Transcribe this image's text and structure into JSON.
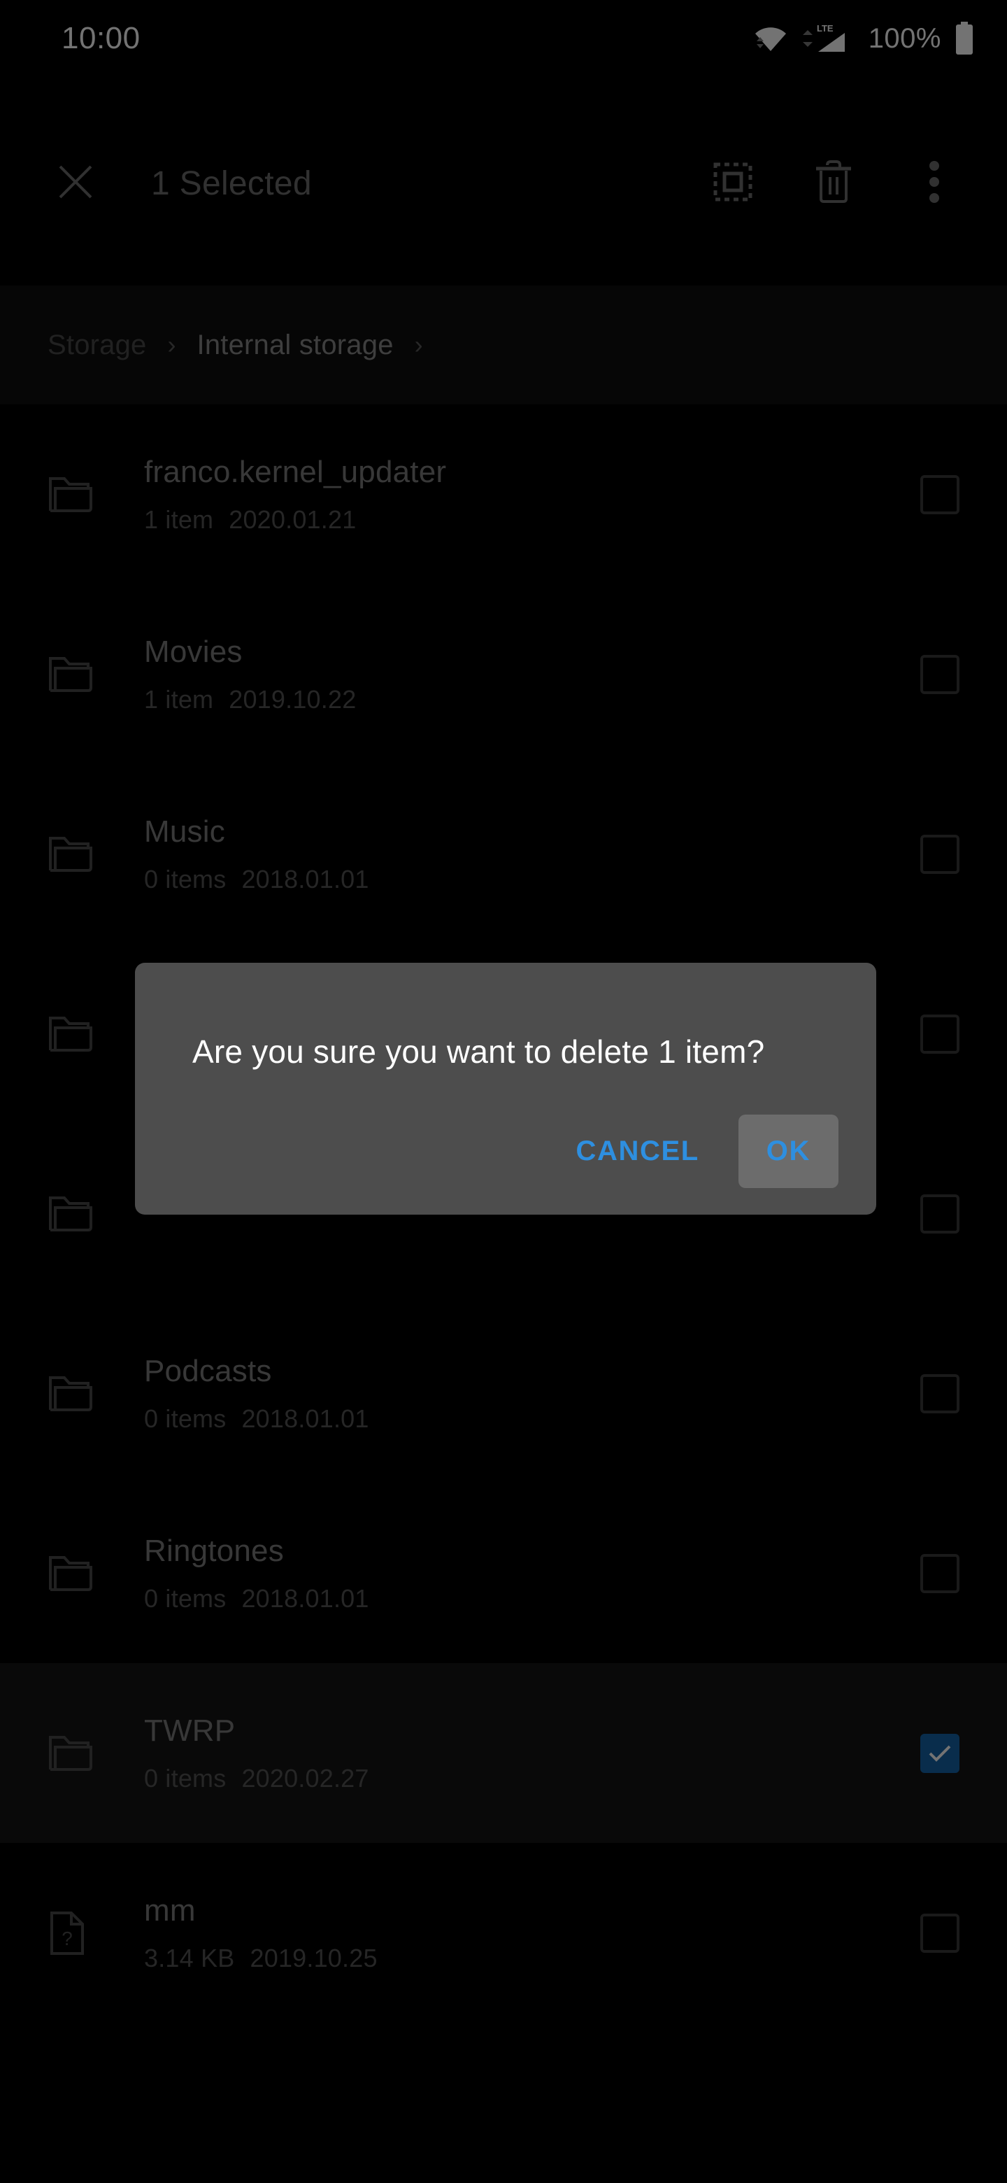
{
  "status_bar": {
    "time": "10:00",
    "battery_percent": "100%",
    "wifi_icon": "wifi-icon",
    "signal_icon": "lte-signal-icon",
    "network_label": "LTE",
    "battery_icon": "battery-full-icon"
  },
  "toolbar": {
    "close_icon": "close-icon",
    "title": "1 Selected",
    "select_all_icon": "select-all-icon",
    "delete_icon": "delete-icon",
    "overflow_icon": "more-vertical-icon"
  },
  "breadcrumb": {
    "items": [
      {
        "label": "Storage",
        "current": false
      },
      {
        "label": "Internal storage",
        "current": true
      }
    ],
    "separator": "›"
  },
  "file_list": {
    "rows": [
      {
        "name": "franco.kernel_updater",
        "count": "1 item",
        "date": "2020.01.21",
        "icon": "folder-icon",
        "checked": false,
        "selected": false,
        "hidden_text": false
      },
      {
        "name": "Movies",
        "count": "1 item",
        "date": "2019.10.22",
        "icon": "folder-icon",
        "checked": false,
        "selected": false,
        "hidden_text": false
      },
      {
        "name": "Music",
        "count": "0 items",
        "date": "2018.01.01",
        "icon": "folder-icon",
        "checked": false,
        "selected": false,
        "hidden_text": false
      },
      {
        "name": "",
        "count": "",
        "date": "",
        "icon": "folder-icon",
        "checked": false,
        "selected": false,
        "hidden_text": true
      },
      {
        "name": "",
        "count": "",
        "date": "",
        "icon": "folder-icon",
        "checked": false,
        "selected": false,
        "hidden_text": true
      },
      {
        "name": "Podcasts",
        "count": "0 items",
        "date": "2018.01.01",
        "icon": "folder-icon",
        "checked": false,
        "selected": false,
        "hidden_text": false
      },
      {
        "name": "Ringtones",
        "count": "0 items",
        "date": "2018.01.01",
        "icon": "folder-icon",
        "checked": false,
        "selected": false,
        "hidden_text": false
      },
      {
        "name": "TWRP",
        "count": "0 items",
        "date": "2020.02.27",
        "icon": "folder-icon",
        "checked": true,
        "selected": true,
        "hidden_text": false
      },
      {
        "name": "mm",
        "count": "3.14 KB",
        "date": "2019.10.25",
        "icon": "unknown-file-icon",
        "checked": false,
        "selected": false,
        "hidden_text": false
      }
    ]
  },
  "dialog": {
    "message": "Are you sure you want to delete 1 item?",
    "cancel_label": "CANCEL",
    "ok_label": "OK",
    "ok_pressed": true
  },
  "colors": {
    "accent_blue": "#2e8fe0",
    "checkbox_checked": "#1565a8",
    "dialog_bg": "#4d4d4d",
    "pressed_bg": "#6c6c6c",
    "row_selected_bg": "#141414",
    "breadcrumb_bg": "#0e0e0e",
    "page_bg": "#000000"
  }
}
